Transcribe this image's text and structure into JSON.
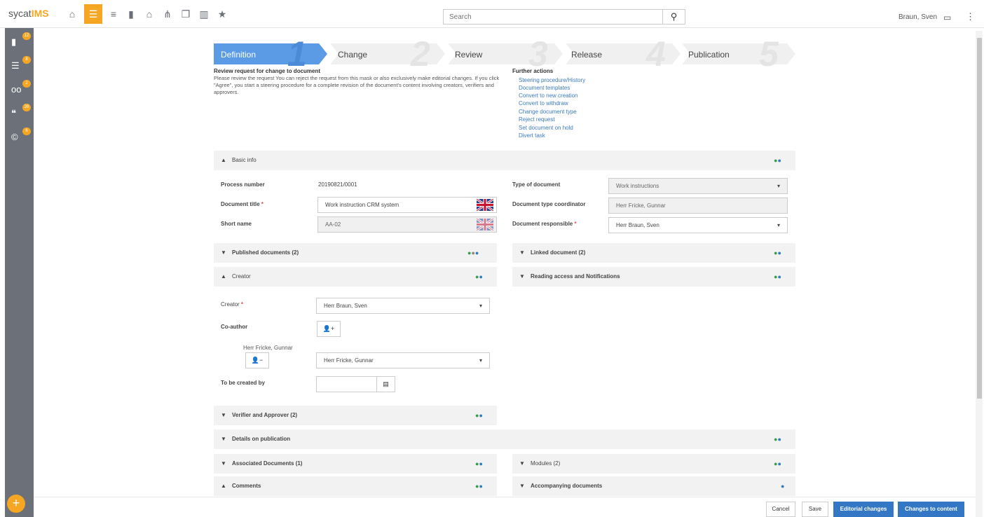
{
  "app": {
    "logo_prefix": "sycat",
    "logo_suffix": "IMS"
  },
  "search": {
    "placeholder": "Search"
  },
  "user": {
    "name": "Braun, Sven"
  },
  "sidebar_badges": [
    "12",
    "8",
    "2",
    "26",
    "6"
  ],
  "steps": [
    {
      "label": "Definition",
      "num": "1"
    },
    {
      "label": "Change",
      "num": "2"
    },
    {
      "label": "Review",
      "num": "3"
    },
    {
      "label": "Release",
      "num": "4"
    },
    {
      "label": "Publication",
      "num": "5"
    }
  ],
  "intro": {
    "title": "Review request for change to document",
    "text": "Please review the request You can reject the request from this mask or also exclusively make editorial changes. If you click \"Agree\", you start a steering procedure for a complete revision of the document's content involving creators, verifiers and approvers."
  },
  "further": {
    "title": "Further actions",
    "links": [
      "Steering procedure/History",
      "Document templates",
      "Convert to new creation",
      "Convert to withdraw",
      "Change document type",
      "Reject request",
      "Set document on hold",
      "Divert task"
    ]
  },
  "basic_info": {
    "title": "Basic info",
    "process_number_label": "Process number",
    "process_number": "20190821/0001",
    "document_title_label": "Document title",
    "document_title": "Work instruction CRM system",
    "short_name_label": "Short name",
    "short_name": "AA-02",
    "type_label": "Type of document",
    "type_value": "Work instructions",
    "coordinator_label": "Document type coordinator",
    "coordinator_value": "Herr Fricke, Gunnar",
    "responsible_label": "Document responsible",
    "responsible_value": "Herr Braun, Sven"
  },
  "panels": {
    "published": "Published documents (2)",
    "linked": "Linked document (2)",
    "creator": "Creator",
    "reading": "Reading access and Notifications",
    "verifier": "Verifier and Approver (2)",
    "publication": "Details on publication",
    "associated": "Associated Documents (1)",
    "modules": "Modules (2)",
    "comments": "Comments",
    "accompanying": "Accompanying documents"
  },
  "creator": {
    "creator_label": "Creator",
    "creator_value": "Herr Braun, Sven",
    "coauthor_label": "Co-author",
    "coauthor_name": "Herr Fricke, Gunnar",
    "coauthor_value": "Herr Fricke, Gunnar",
    "tobecreated_label": "To be created by"
  },
  "buttons": {
    "cancel": "Cancel",
    "save": "Save",
    "editorial": "Editorial changes",
    "content": "Changes to content"
  },
  "colors": {
    "accent": "#f5a623",
    "primary": "#3478c5",
    "step_active": "#5b9be6"
  }
}
